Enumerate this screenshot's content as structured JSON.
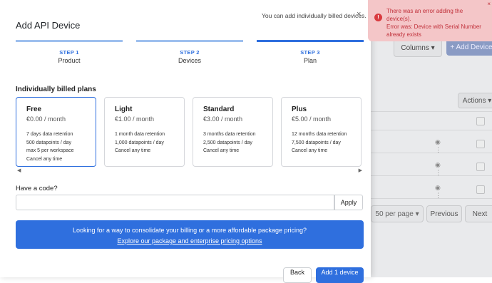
{
  "modal": {
    "title": "Add API Device",
    "hint": "You can add individually billed devices.",
    "close_glyph": "×"
  },
  "steps": [
    {
      "num": "STEP 1",
      "name": "Product"
    },
    {
      "num": "STEP 2",
      "name": "Devices"
    },
    {
      "num": "STEP 3",
      "name": "Plan"
    }
  ],
  "plans_section": {
    "title": "Individually billed plans",
    "left_arrow": "◀",
    "right_arrow": "▶"
  },
  "plans": [
    {
      "name": "Free",
      "price": "€0.00 / month",
      "features": [
        "7 days data retention",
        "500 datapoints / day",
        "max 5 per workspace",
        "Cancel any time"
      ]
    },
    {
      "name": "Light",
      "price": "€1.00 / month",
      "features": [
        "1 month data retention",
        "1,000 datapoints / day",
        "Cancel any time"
      ]
    },
    {
      "name": "Standard",
      "price": "€3.00 / month",
      "features": [
        "3 months data retention",
        "2,500 datapoints / day",
        "Cancel any time"
      ]
    },
    {
      "name": "Plus",
      "price": "€5.00 / month",
      "features": [
        "12 months data retention",
        "7,500 datapoints / day",
        "Cancel any time"
      ]
    }
  ],
  "code": {
    "label": "Have a code?",
    "value": "",
    "placeholder": "",
    "apply_label": "Apply"
  },
  "promo": {
    "question": "Looking for a way to consolidate your billing or a more affordable package pricing?",
    "link": "Explore our package and enterprise pricing options"
  },
  "footer": {
    "back_label": "Back",
    "primary_label": "Add 1 device"
  },
  "toast": {
    "icon_glyph": "!",
    "lines": [
      "There was an error adding the device(s).",
      "Error was: Device with Serial Number",
      "already exists"
    ],
    "close_glyph": "×"
  },
  "background": {
    "columns_label": "Columns ▾",
    "add_device_label": "+ Add Device",
    "actions_label": "Actions ▾",
    "per_page_label": "50 per page ▾",
    "previous_label": "Previous",
    "next_label": "Next",
    "row_icon": "◉ ⋮"
  },
  "colors": {
    "accent": "#2f6fde",
    "error": "#d93a3f",
    "toast_bg": "#f4c6c8"
  }
}
